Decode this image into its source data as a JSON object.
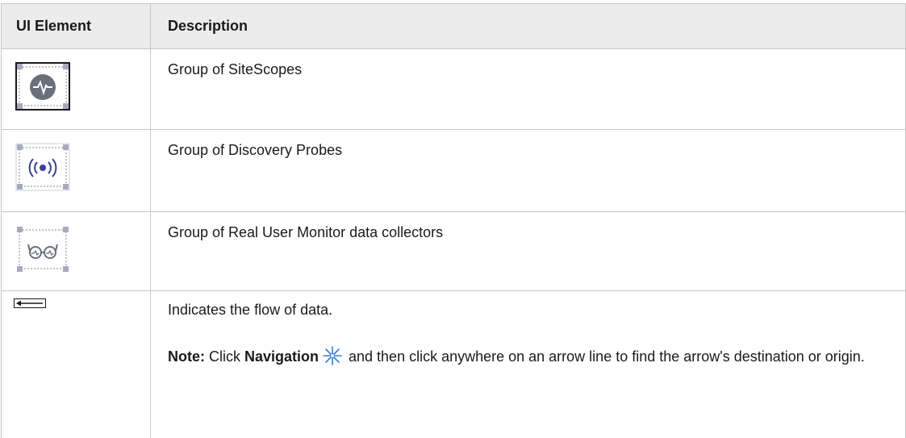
{
  "table": {
    "headers": {
      "ui_element": "UI Element",
      "description": "Description"
    },
    "rows": [
      {
        "icon": "sitescope-group-icon",
        "description": "Group of SiteScopes"
      },
      {
        "icon": "discovery-probe-group-icon",
        "description": "Group of Discovery Probes"
      },
      {
        "icon": "rum-collector-group-icon",
        "description": "Group of Real User Monitor data collectors"
      },
      {
        "icon": "flow-arrow-icon",
        "description": "Indicates the flow of data.",
        "note": {
          "label": "Note:",
          "text_before": " Click ",
          "bold_word": "Navigation",
          "nav_icon": "navigation-star-icon",
          "text_after": " and then click anywhere on an arrow line to find the arrow's destination or origin."
        }
      }
    ]
  },
  "colors": {
    "header_bg": "#ececec",
    "border": "#c6c6c6",
    "icon_handle": "#a7a9c4",
    "icon_dark": "#6b6f7c",
    "nav_icon": "#3a7bd5"
  }
}
